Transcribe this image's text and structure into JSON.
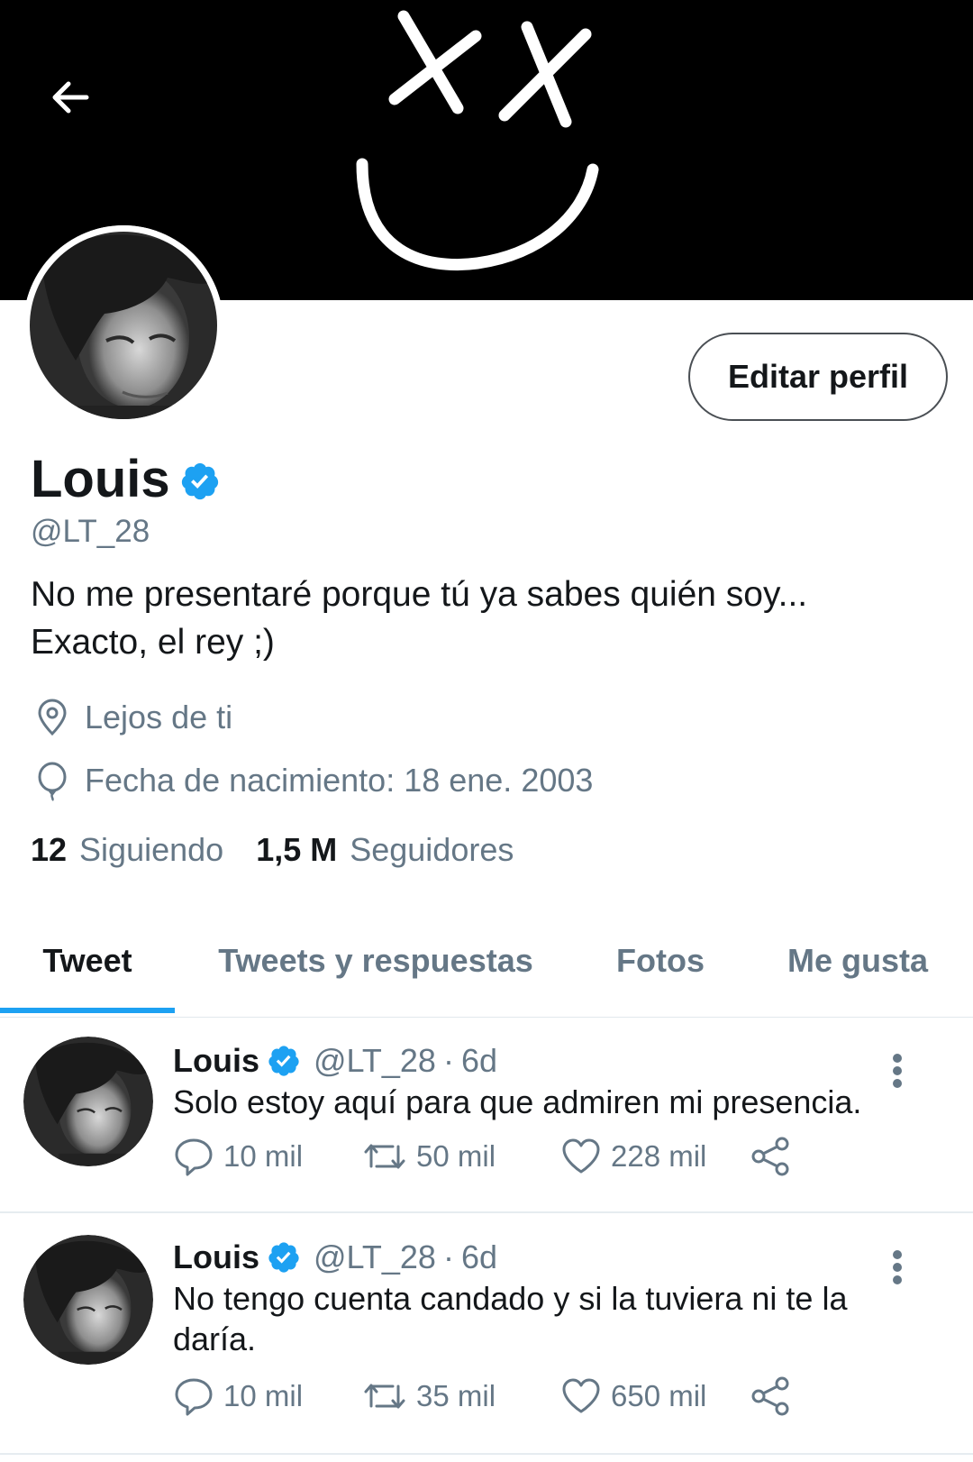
{
  "header": {
    "back_icon": "arrow-left-icon",
    "banner_art": "xx-smiley-face"
  },
  "profile": {
    "display_name": "Louis",
    "verified": true,
    "handle": "@LT_28",
    "bio_line1": "No me presentaré porque tú ya sabes quién soy...",
    "bio_line2": "Exacto, el rey ;)",
    "location": "Lejos de ti",
    "birthday": "Fecha de nacimiento: 18 ene. 2003",
    "edit_button": "Editar perfil",
    "following_count": "12",
    "following_label": "Siguiendo",
    "followers_count": "1,5 M",
    "followers_label": "Seguidores"
  },
  "tabs": [
    {
      "label": "Tweet",
      "active": true
    },
    {
      "label": "Tweets y respuestas",
      "active": false
    },
    {
      "label": "Fotos",
      "active": false
    },
    {
      "label": "Me gusta",
      "active": false
    }
  ],
  "tweets": [
    {
      "name": "Louis",
      "handle": "@LT_28",
      "separator": "·",
      "time": "6d",
      "text": "Solo estoy aquí para que admiren mi presencia.",
      "replies": "10 mil",
      "retweets": "50 mil",
      "likes": "228 mil"
    },
    {
      "name": "Louis",
      "handle": "@LT_28",
      "separator": "·",
      "time": "6d",
      "text": "No tengo cuenta candado y si la tuviera ni te la daría.",
      "replies": "10 mil",
      "retweets": "35 mil",
      "likes": "650 mil"
    }
  ],
  "colors": {
    "accent": "#1da1f2",
    "text_primary": "#14171a",
    "text_secondary": "#657786",
    "banner": "#000000"
  }
}
